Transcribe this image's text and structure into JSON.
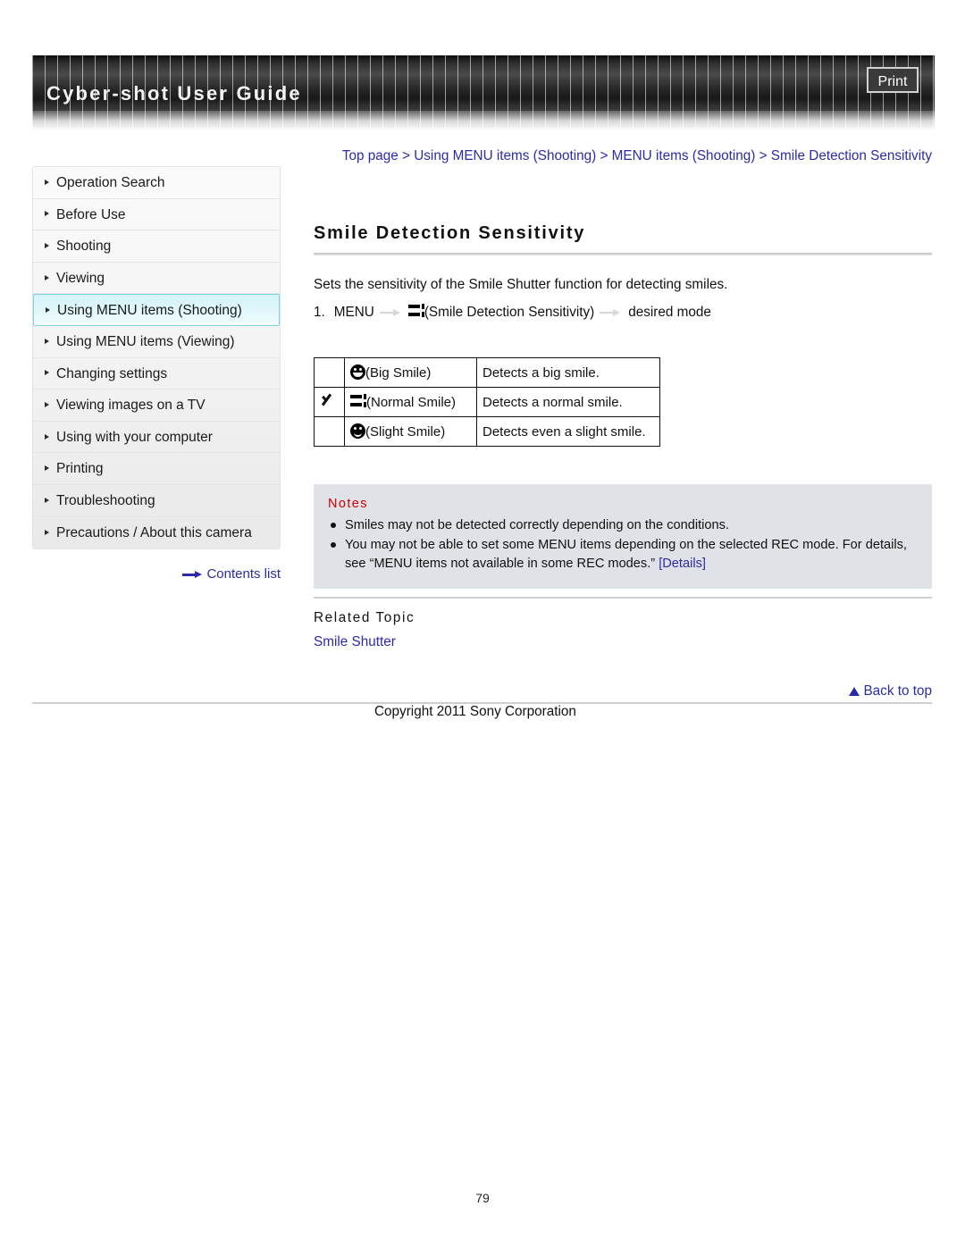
{
  "header": {
    "title": "Cyber-shot User Guide",
    "print_label": "Print"
  },
  "sidebar": {
    "items": [
      {
        "label": "Operation Search",
        "active": false
      },
      {
        "label": "Before Use",
        "active": false
      },
      {
        "label": "Shooting",
        "active": false
      },
      {
        "label": "Viewing",
        "active": false
      },
      {
        "label": "Using MENU items (Shooting)",
        "active": true
      },
      {
        "label": "Using MENU items (Viewing)",
        "active": false
      },
      {
        "label": "Changing settings",
        "active": false
      },
      {
        "label": "Viewing images on a TV",
        "active": false
      },
      {
        "label": "Using with your computer",
        "active": false
      },
      {
        "label": "Printing",
        "active": false
      },
      {
        "label": "Troubleshooting",
        "active": false
      },
      {
        "label": "Precautions / About this camera",
        "active": false
      }
    ],
    "contents_list_label": "Contents list"
  },
  "main": {
    "breadcrumb": "Top page > Using MENU items (Shooting) > MENU items (Shooting) > Smile Detection Sensitivity",
    "page_title": "Smile Detection Sensitivity",
    "intro": "Sets the sensitivity of the Smile Shutter function for detecting smiles.",
    "step": {
      "number": "1.",
      "part1": "MENU",
      "part2": "(Smile Detection Sensitivity)",
      "part3": "desired mode"
    },
    "table": {
      "rows": [
        {
          "selected": "",
          "icon": "big-smile-icon",
          "label": "(Big Smile)",
          "description": "Detects a big smile."
        },
        {
          "selected": "✓",
          "icon": "normal-smile-icon",
          "label": "(Normal Smile)",
          "description": "Detects a normal smile."
        },
        {
          "selected": "",
          "icon": "slight-smile-icon",
          "label": "(Slight Smile)",
          "description": "Detects even a slight smile."
        }
      ]
    },
    "notes": {
      "title": "Notes",
      "items": [
        "Smiles may not be detected correctly depending on the conditions.",
        "You may not be able to set some MENU items depending on the selected REC mode. For details, see “MENU items not available in some REC modes.”"
      ],
      "details_link": "[Details]"
    },
    "related": {
      "title": "Related Topic",
      "link": "Smile Shutter"
    }
  },
  "footer": {
    "back_to_top": "Back to top",
    "copyright": "Copyright 2011 Sony Corporation",
    "page_number": "79"
  },
  "colors": {
    "link": "#2b2baa",
    "notes_title": "#cc0000",
    "notes_bg": "#dfe2e6",
    "active_nav_border": "#7fd3e4"
  }
}
